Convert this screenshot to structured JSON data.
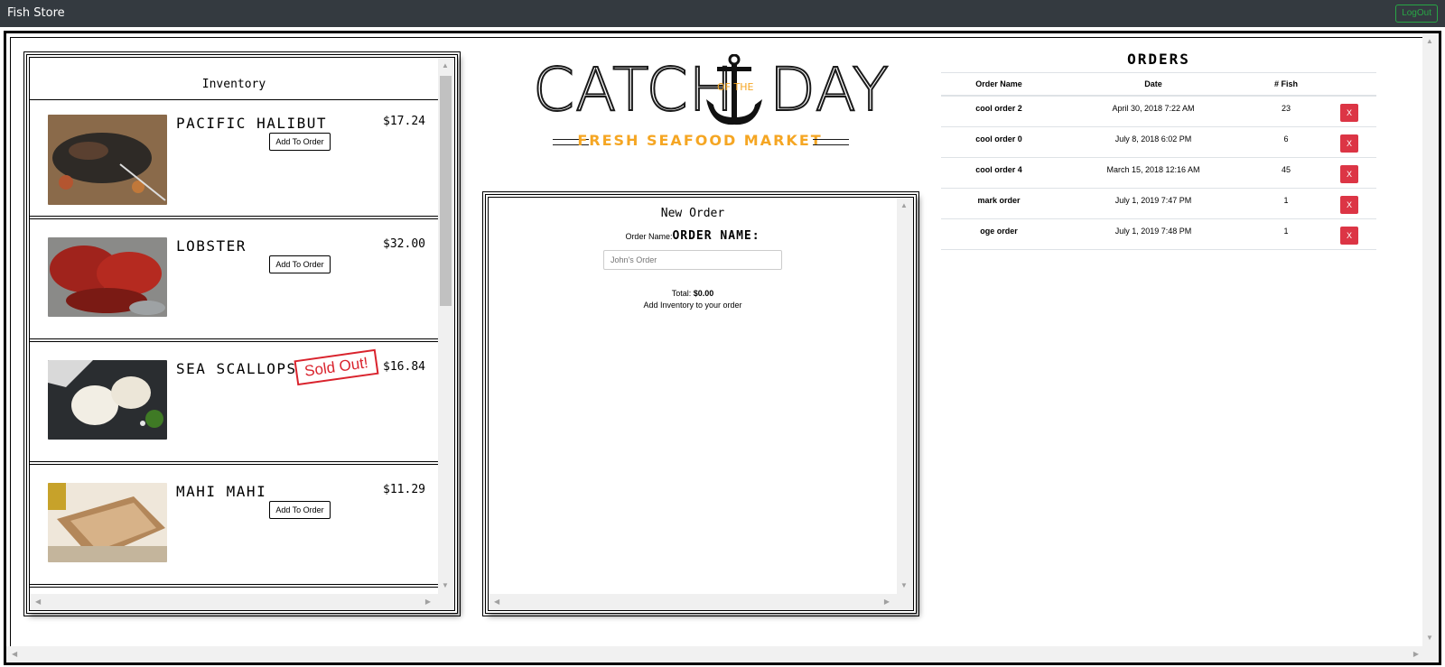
{
  "nav": {
    "brand": "Fish Store",
    "logout_label": "LogOut"
  },
  "inventory": {
    "title": "Inventory",
    "items": [
      {
        "name": "Pacific Halibut",
        "price": "$17.24",
        "status": "available",
        "button_label": "Add To Order"
      },
      {
        "name": "Lobster",
        "price": "$32.00",
        "status": "available",
        "button_label": "Add To Order"
      },
      {
        "name": "Sea Scallops",
        "price": "$16.84",
        "status": "unavailable",
        "sold_out_label": "Sold Out!"
      },
      {
        "name": "Mahi Mahi",
        "price": "$11.29",
        "status": "available",
        "button_label": "Add To Order"
      }
    ]
  },
  "logo": {
    "word1": "CATCH",
    "of_the": "OF THE",
    "word2": "DAY",
    "tagline": "FRESH SEAFOOD MARKET"
  },
  "new_order": {
    "title": "New Order",
    "label_small": "Order Name:",
    "label_big": "ORDER NAME:",
    "input_placeholder": "John's Order",
    "total_label": "Total:",
    "total_value": "$0.00",
    "hint": "Add Inventory to your order"
  },
  "orders": {
    "title": "ORDERS",
    "columns": [
      "Order Name",
      "Date",
      "# Fish"
    ],
    "rows": [
      {
        "name": "cool order 2",
        "date": "April 30, 2018 7:22 AM",
        "fish": "23",
        "delete_label": "X"
      },
      {
        "name": "cool order 0",
        "date": "July 8, 2018 6:02 PM",
        "fish": "6",
        "delete_label": "X"
      },
      {
        "name": "cool order 4",
        "date": "March 15, 2018 12:16 AM",
        "fish": "45",
        "delete_label": "X"
      },
      {
        "name": "mark order",
        "date": "July 1, 2019 7:47 PM",
        "fish": "1",
        "delete_label": "X"
      },
      {
        "name": "oge order",
        "date": "July 1, 2019 7:48 PM",
        "fish": "1",
        "delete_label": "X"
      }
    ]
  },
  "colors": {
    "navbar": "#343a40",
    "logout": "#28a745",
    "accent_orange": "#f5a623",
    "delete": "#dc3545",
    "sold_out": "#d9232d"
  }
}
